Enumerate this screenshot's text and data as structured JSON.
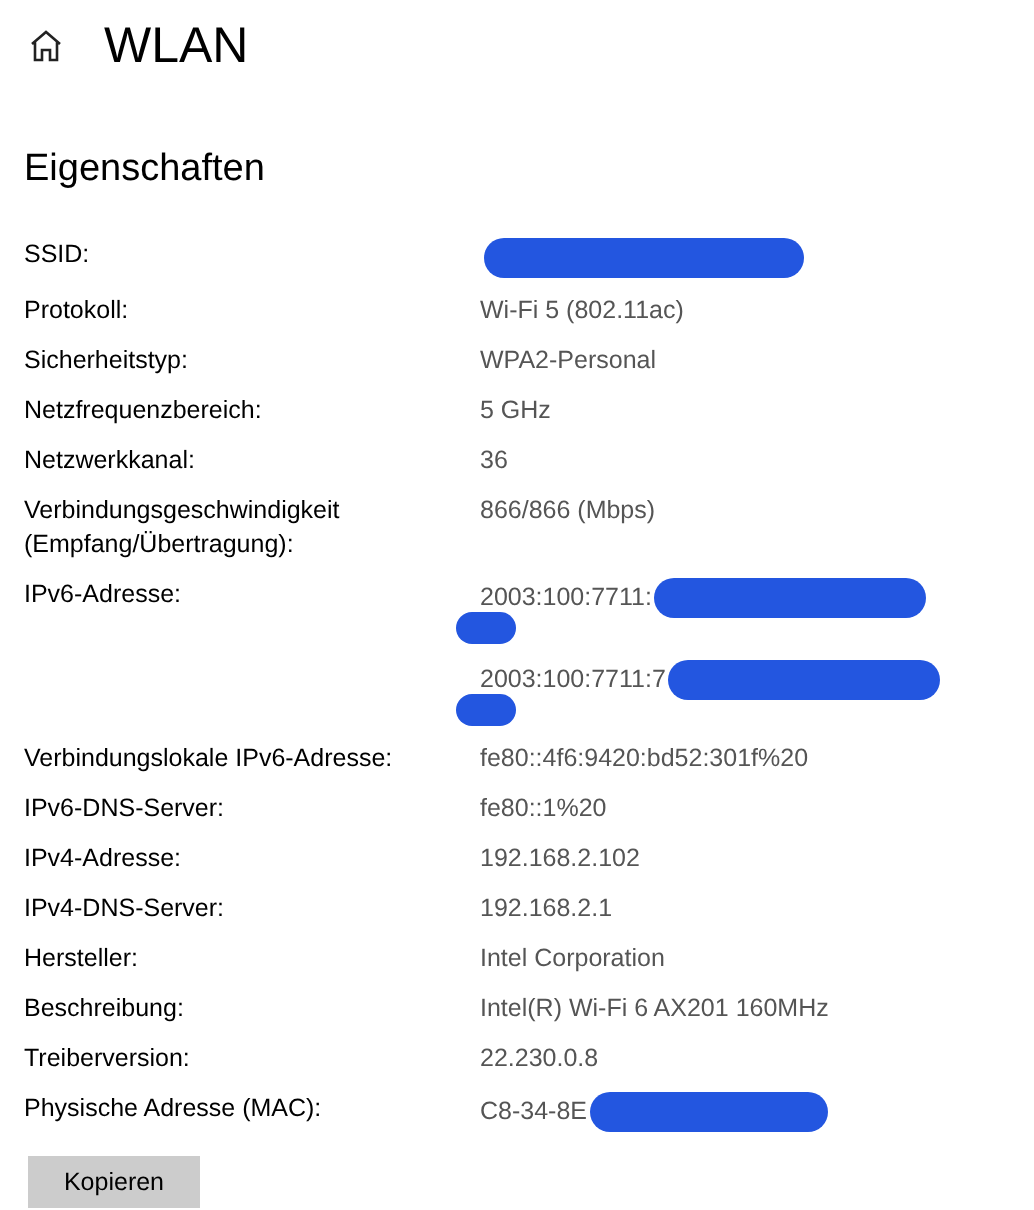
{
  "header": {
    "title": "WLAN"
  },
  "section": {
    "title": "Eigenschaften"
  },
  "properties": [
    {
      "label": "SSID:",
      "values": [
        {
          "redacted": true,
          "wraps": false
        }
      ]
    },
    {
      "label": "Protokoll:",
      "values": [
        {
          "text": "Wi-Fi 5 (802.11ac)",
          "redacted": false
        }
      ]
    },
    {
      "label": "Sicherheitstyp:",
      "values": [
        {
          "text": "WPA2-Personal",
          "redacted": false
        }
      ]
    },
    {
      "label": "Netzfrequenzbereich:",
      "values": [
        {
          "text": "5 GHz",
          "redacted": false
        }
      ]
    },
    {
      "label": "Netzwerkkanal:",
      "values": [
        {
          "text": "36",
          "redacted": false
        }
      ]
    },
    {
      "label": "Verbindungsgeschwindigkeit (Empfang/Übertragung):",
      "values": [
        {
          "text": "866/866 (Mbps)",
          "redacted": false
        }
      ]
    },
    {
      "label": "IPv6-Adresse:",
      "values": [
        {
          "text": "2003:100:7711:",
          "redacted": true,
          "wraps": true
        },
        {
          "text": "2003:100:7711:7",
          "redacted": true,
          "wraps": true
        }
      ]
    },
    {
      "label": "Verbindungslokale IPv6-Adresse:",
      "values": [
        {
          "text": "fe80::4f6:9420:bd52:301f%20",
          "redacted": false
        }
      ]
    },
    {
      "label": "IPv6-DNS-Server:",
      "values": [
        {
          "text": "fe80::1%20",
          "redacted": false
        }
      ]
    },
    {
      "label": "IPv4-Adresse:",
      "values": [
        {
          "text": "192.168.2.102",
          "redacted": false
        }
      ]
    },
    {
      "label": "IPv4-DNS-Server:",
      "values": [
        {
          "text": "192.168.2.1",
          "redacted": false
        }
      ]
    },
    {
      "label": "Hersteller:",
      "values": [
        {
          "text": "Intel Corporation",
          "redacted": false
        }
      ]
    },
    {
      "label": "Beschreibung:",
      "values": [
        {
          "text": "Intel(R) Wi-Fi 6 AX201 160MHz",
          "redacted": false
        }
      ]
    },
    {
      "label": "Treiberversion:",
      "values": [
        {
          "text": "22.230.0.8",
          "redacted": false
        }
      ]
    },
    {
      "label": "Physische Adresse (MAC):",
      "values": [
        {
          "text": "C8-34-8E",
          "redacted": true,
          "wraps": false
        }
      ]
    }
  ],
  "copy_button": {
    "label": "Kopieren"
  }
}
